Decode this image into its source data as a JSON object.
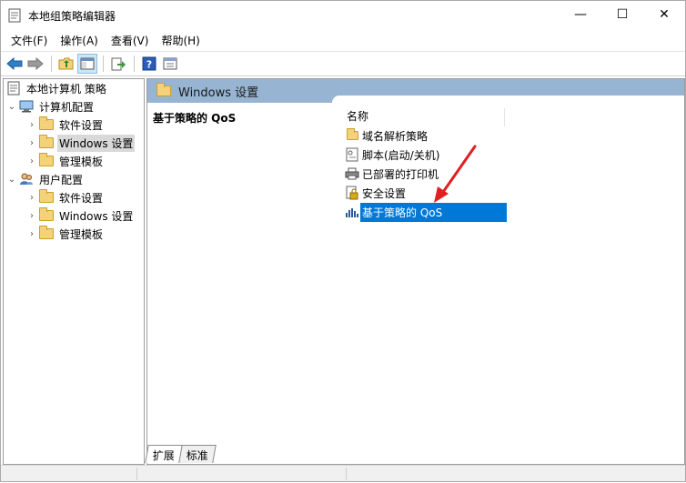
{
  "window": {
    "title": "本地组策略编辑器",
    "minimize_label": "—",
    "maximize_label": "☐",
    "close_label": "✕"
  },
  "menubar": {
    "items": [
      {
        "label": "文件(F)"
      },
      {
        "label": "操作(A)"
      },
      {
        "label": "查看(V)"
      },
      {
        "label": "帮助(H)"
      }
    ]
  },
  "toolbar": {
    "buttons": [
      {
        "icon": "back-arrow-icon"
      },
      {
        "icon": "forward-arrow-icon"
      },
      {
        "icon": "up-folder-icon"
      },
      {
        "icon": "show-hide-console-tree-icon"
      },
      {
        "icon": "export-list-icon"
      },
      {
        "icon": "help-icon"
      },
      {
        "icon": "properties-icon"
      }
    ]
  },
  "tree": {
    "root": {
      "label": "本地计算机 策略"
    },
    "computer": {
      "label": "计算机配置"
    },
    "computer_children": [
      {
        "label": "软件设置"
      },
      {
        "label": "Windows 设置"
      },
      {
        "label": "管理模板"
      }
    ],
    "user": {
      "label": "用户配置"
    },
    "user_children": [
      {
        "label": "软件设置"
      },
      {
        "label": "Windows 设置"
      },
      {
        "label": "管理模板"
      }
    ]
  },
  "details": {
    "header_label": "Windows 设置",
    "description_title": "基于策略的 QoS",
    "column_name": "名称",
    "items": [
      {
        "label": "域名解析策略",
        "icon": "folder-icon"
      },
      {
        "label": "脚本(启动/关机)",
        "icon": "script-icon"
      },
      {
        "label": "已部署的打印机",
        "icon": "printer-icon"
      },
      {
        "label": "安全设置",
        "icon": "security-icon"
      },
      {
        "label": "基于策略的 QoS",
        "icon": "qos-chart-icon",
        "selected": true
      }
    ]
  },
  "tabs": [
    {
      "label": "扩展"
    },
    {
      "label": "标准"
    }
  ],
  "colors": {
    "selection": "#0078d7",
    "header_band": "#97b5d3",
    "annotation_arrow": "#e02020"
  }
}
